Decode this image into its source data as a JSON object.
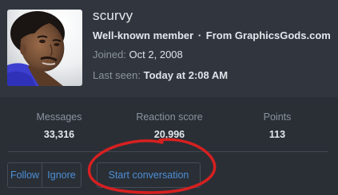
{
  "profile": {
    "username": "scurvy",
    "title": "Well-known member",
    "separator": "·",
    "from": "From GraphicsGods.com",
    "joined_label": "Joined:",
    "joined_value": "Oct 2, 2008",
    "last_seen_label": "Last seen:",
    "last_seen_value": "Today at 2:08 AM"
  },
  "stats": [
    {
      "label": "Messages",
      "value": "33,316"
    },
    {
      "label": "Reaction score",
      "value": "20,996"
    },
    {
      "label": "Points",
      "value": "113"
    }
  ],
  "actions": {
    "follow": "Follow",
    "ignore": "Ignore",
    "start_conversation": "Start conversation"
  },
  "colors": {
    "background": "#2a2f36",
    "link": "#4d8fd6",
    "annotation": "#d62020"
  }
}
